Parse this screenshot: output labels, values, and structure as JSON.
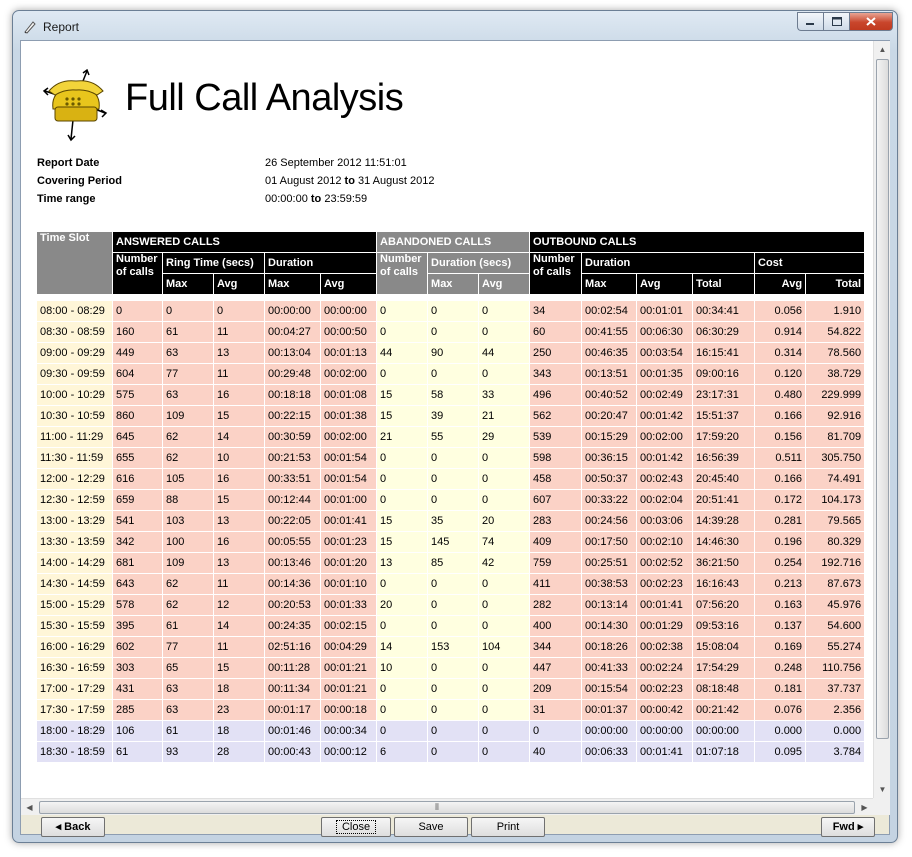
{
  "window": {
    "title": "Report"
  },
  "report": {
    "title": "Full Call Analysis",
    "meta": [
      {
        "label": "Report Date",
        "value": "26 September 2012 11:51:01",
        "from": "",
        "to_word": "",
        "to": ""
      },
      {
        "label": "Covering Period",
        "value": "",
        "from": "01 August 2012",
        "to_word": "to",
        "to": "31 August 2012"
      },
      {
        "label": "Time range",
        "value": "",
        "from": "00:00:00",
        "to_word": "to",
        "to": "23:59:59"
      }
    ]
  },
  "table": {
    "headers": {
      "time_slot": "Time Slot",
      "answered": "ANSWERED CALLS",
      "abandoned": "ABANDONED CALLS",
      "outbound": "OUTBOUND CALLS",
      "number_of_calls_1": "Number",
      "number_of_calls_2": "of calls",
      "ring_time": "Ring Time (secs)",
      "duration": "Duration",
      "duration_secs": "Duration (secs)",
      "cost": "Cost",
      "max": "Max",
      "avg": "Avg",
      "total": "Total"
    },
    "rows": [
      [
        "08:00 - 08:29",
        "0",
        "0",
        "0",
        "00:00:00",
        "00:00:00",
        "0",
        "0",
        "0",
        "34",
        "00:02:54",
        "00:01:01",
        "00:34:41",
        "0.056",
        "1.910"
      ],
      [
        "08:30 - 08:59",
        "160",
        "61",
        "11",
        "00:04:27",
        "00:00:50",
        "0",
        "0",
        "0",
        "60",
        "00:41:55",
        "00:06:30",
        "06:30:29",
        "0.914",
        "54.822"
      ],
      [
        "09:00 - 09:29",
        "449",
        "63",
        "13",
        "00:13:04",
        "00:01:13",
        "44",
        "90",
        "44",
        "250",
        "00:46:35",
        "00:03:54",
        "16:15:41",
        "0.314",
        "78.560"
      ],
      [
        "09:30 - 09:59",
        "604",
        "77",
        "11",
        "00:29:48",
        "00:02:00",
        "0",
        "0",
        "0",
        "343",
        "00:13:51",
        "00:01:35",
        "09:00:16",
        "0.120",
        "38.729"
      ],
      [
        "10:00 - 10:29",
        "575",
        "63",
        "16",
        "00:18:18",
        "00:01:08",
        "15",
        "58",
        "33",
        "496",
        "00:40:52",
        "00:02:49",
        "23:17:31",
        "0.480",
        "229.999"
      ],
      [
        "10:30 - 10:59",
        "860",
        "109",
        "15",
        "00:22:15",
        "00:01:38",
        "15",
        "39",
        "21",
        "562",
        "00:20:47",
        "00:01:42",
        "15:51:37",
        "0.166",
        "92.916"
      ],
      [
        "11:00 - 11:29",
        "645",
        "62",
        "14",
        "00:30:59",
        "00:02:00",
        "21",
        "55",
        "29",
        "539",
        "00:15:29",
        "00:02:00",
        "17:59:20",
        "0.156",
        "81.709"
      ],
      [
        "11:30 - 11:59",
        "655",
        "62",
        "10",
        "00:21:53",
        "00:01:54",
        "0",
        "0",
        "0",
        "598",
        "00:36:15",
        "00:01:42",
        "16:56:39",
        "0.511",
        "305.750"
      ],
      [
        "12:00 - 12:29",
        "616",
        "105",
        "16",
        "00:33:51",
        "00:01:54",
        "0",
        "0",
        "0",
        "458",
        "00:50:37",
        "00:02:43",
        "20:45:40",
        "0.166",
        "74.491"
      ],
      [
        "12:30 - 12:59",
        "659",
        "88",
        "15",
        "00:12:44",
        "00:01:00",
        "0",
        "0",
        "0",
        "607",
        "00:33:22",
        "00:02:04",
        "20:51:41",
        "0.172",
        "104.173"
      ],
      [
        "13:00 - 13:29",
        "541",
        "103",
        "13",
        "00:22:05",
        "00:01:41",
        "15",
        "35",
        "20",
        "283",
        "00:24:56",
        "00:03:06",
        "14:39:28",
        "0.281",
        "79.565"
      ],
      [
        "13:30 - 13:59",
        "342",
        "100",
        "16",
        "00:05:55",
        "00:01:23",
        "15",
        "145",
        "74",
        "409",
        "00:17:50",
        "00:02:10",
        "14:46:30",
        "0.196",
        "80.329"
      ],
      [
        "14:00 - 14:29",
        "681",
        "109",
        "13",
        "00:13:46",
        "00:01:20",
        "13",
        "85",
        "42",
        "759",
        "00:25:51",
        "00:02:52",
        "36:21:50",
        "0.254",
        "192.716"
      ],
      [
        "14:30 - 14:59",
        "643",
        "62",
        "11",
        "00:14:36",
        "00:01:10",
        "0",
        "0",
        "0",
        "411",
        "00:38:53",
        "00:02:23",
        "16:16:43",
        "0.213",
        "87.673"
      ],
      [
        "15:00 - 15:29",
        "578",
        "62",
        "12",
        "00:20:53",
        "00:01:33",
        "20",
        "0",
        "0",
        "282",
        "00:13:14",
        "00:01:41",
        "07:56:20",
        "0.163",
        "45.976"
      ],
      [
        "15:30 - 15:59",
        "395",
        "61",
        "14",
        "00:24:35",
        "00:02:15",
        "0",
        "0",
        "0",
        "400",
        "00:14:30",
        "00:01:29",
        "09:53:16",
        "0.137",
        "54.600"
      ],
      [
        "16:00 - 16:29",
        "602",
        "77",
        "11",
        "02:51:16",
        "00:04:29",
        "14",
        "153",
        "104",
        "344",
        "00:18:26",
        "00:02:38",
        "15:08:04",
        "0.169",
        "55.274"
      ],
      [
        "16:30 - 16:59",
        "303",
        "65",
        "15",
        "00:11:28",
        "00:01:21",
        "10",
        "0",
        "0",
        "447",
        "00:41:33",
        "00:02:24",
        "17:54:29",
        "0.248",
        "110.756"
      ],
      [
        "17:00 - 17:29",
        "431",
        "63",
        "18",
        "00:11:34",
        "00:01:21",
        "0",
        "0",
        "0",
        "209",
        "00:15:54",
        "00:02:23",
        "08:18:48",
        "0.181",
        "37.737"
      ],
      [
        "17:30 - 17:59",
        "285",
        "63",
        "23",
        "00:01:17",
        "00:00:18",
        "0",
        "0",
        "0",
        "31",
        "00:01:37",
        "00:00:42",
        "00:21:42",
        "0.076",
        "2.356"
      ],
      [
        "18:00 - 18:29",
        "106",
        "61",
        "18",
        "00:01:46",
        "00:00:34",
        "0",
        "0",
        "0",
        "0",
        "00:00:00",
        "00:00:00",
        "00:00:00",
        "0.000",
        "0.000"
      ],
      [
        "18:30 - 18:59",
        "61",
        "93",
        "28",
        "00:00:43",
        "00:00:12",
        "6",
        "0",
        "0",
        "40",
        "00:06:33",
        "00:01:41",
        "01:07:18",
        "0.095",
        "3.784"
      ]
    ]
  },
  "buttons": {
    "back": "Back",
    "close": "Close",
    "save": "Save",
    "print": "Print",
    "fwd": "Fwd"
  },
  "colors": {
    "answered_bg": "#fbd2c6",
    "abandoned_bg": "#ffffe0",
    "timeslot_bg": "#fff6d8",
    "evening_bg": "#e2e1f5",
    "header_black": "#000000",
    "header_grey": "#898989"
  }
}
